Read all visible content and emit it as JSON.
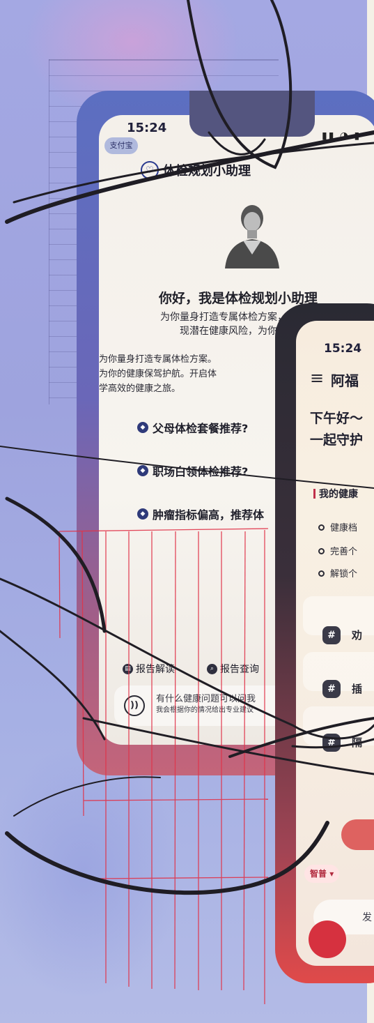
{
  "colors": {
    "background": "#a4a8e3",
    "phone1_frame": "#5c6fc1",
    "phone2_frame": "#2a2a33",
    "accent_red": "#d6313f",
    "pen_ink": "#1f1d24",
    "guide_red": "#e0344a"
  },
  "phone1": {
    "status": {
      "time": "15:24",
      "capsule": "支付宝"
    },
    "header": {
      "title": "体检规划小助理",
      "logo_icon": "assistant-logo-icon"
    },
    "greeting": "你好，我是体检规划小助理",
    "intro_lines": [
      "为你量身打造专属体检方案，省心又",
      "现潜在健康风险，为你的健"
    ],
    "body_lines": [
      "为你量身打造专属体检方案。",
      "为你的健康保驾护航。开启体",
      "学高效的健康之旅。"
    ],
    "questions": [
      {
        "label": "父母体检套餐推荐?"
      },
      {
        "label": "职场白领体检推荐?"
      },
      {
        "label": "肿瘤指标偏高，推荐体"
      }
    ],
    "tools": [
      {
        "label": "报告解读"
      },
      {
        "label": "报告查询"
      }
    ],
    "input": {
      "line1": "有什么健康问题可以问我",
      "line2": "我会根据你的情况给出专业建议"
    }
  },
  "phone2": {
    "status": {
      "time": "15:24"
    },
    "user_name": "阿福",
    "greeting_lines": [
      "下午好～",
      "一起守护"
    ],
    "section_title": "我的健康",
    "list_items": [
      {
        "label": "健康档"
      },
      {
        "label": "完善个"
      },
      {
        "label": "解锁个"
      }
    ],
    "cards": [
      {
        "label": "劝"
      },
      {
        "label": "插"
      },
      {
        "label": "隔"
      }
    ],
    "chip": "智普",
    "send_label": "发"
  }
}
